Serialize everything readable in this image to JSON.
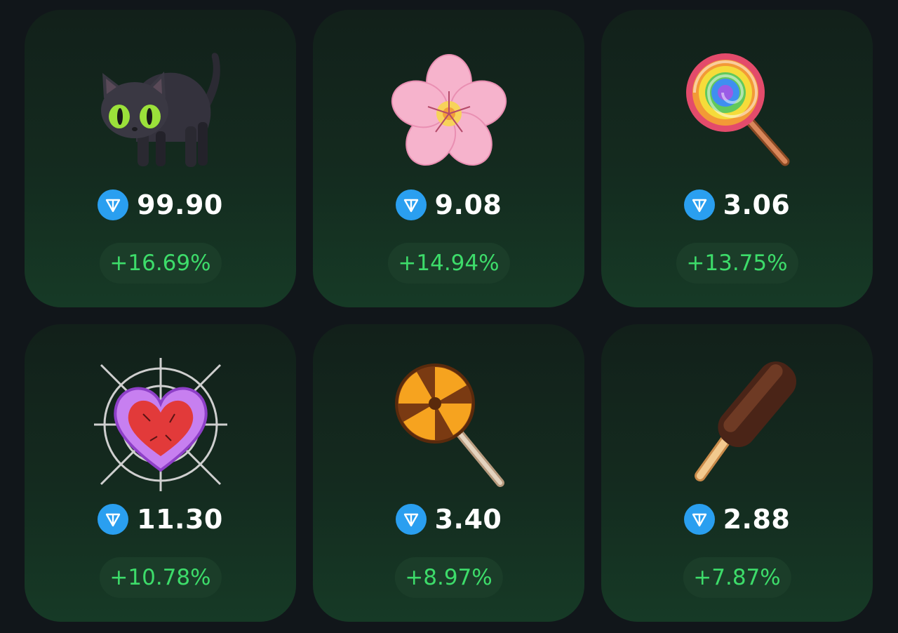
{
  "currency_icon": "ton-diamond-icon",
  "colors": {
    "background": "#11161a",
    "card": "#142b1f",
    "price_text": "#ffffff",
    "change_text": "#3ddc6a",
    "change_pill": "#1b3d29",
    "ton_blue": "#2a9ff0"
  },
  "items": [
    {
      "icon": "black-cat-icon",
      "price": "99.90",
      "change": "+16.69%"
    },
    {
      "icon": "cherry-blossom-icon",
      "price": "9.08",
      "change": "+14.94%"
    },
    {
      "icon": "rainbow-lollipop-icon",
      "price": "3.06",
      "change": "+13.75%"
    },
    {
      "icon": "spider-web-heart-icon",
      "price": "11.30",
      "change": "+10.78%"
    },
    {
      "icon": "swirl-lollipop-icon",
      "price": "3.40",
      "change": "+8.97%"
    },
    {
      "icon": "chocolate-ice-pop-icon",
      "price": "2.88",
      "change": "+7.87%"
    }
  ]
}
